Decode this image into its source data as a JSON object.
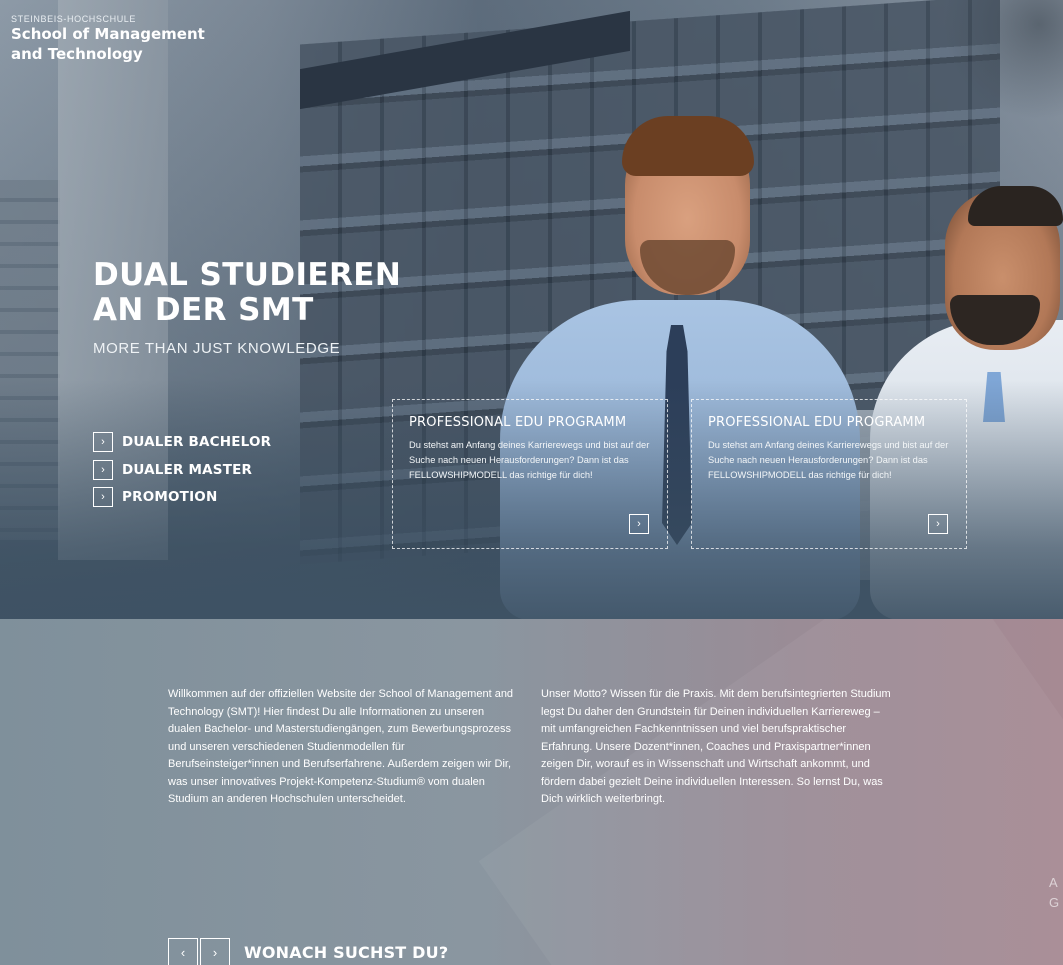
{
  "brand": {
    "small": "STEINBEIS-HOCHSCHULE",
    "line1": "School of Management",
    "line2": "and Technology"
  },
  "hero": {
    "title_line1": "DUAL STUDIEREN",
    "title_line2": "AN DER SMT",
    "subtitle": "MORE THAN JUST KNOWLEDGE",
    "nav": [
      {
        "icon": "chevron-right-icon",
        "glyph": "›",
        "label": "DUALER BACHELOR"
      },
      {
        "icon": "chevron-right-icon",
        "glyph": "›",
        "label": "DUALER MASTER"
      },
      {
        "icon": "chevron-right-icon",
        "glyph": "›",
        "label": "PROMOTION"
      }
    ],
    "cards": [
      {
        "title": "PROFESSIONAL EDU PROGRAMM",
        "text": "Du stehst am Anfang deines Karrierewegs und bist auf der Suche nach neuen Herausforderungen? Dann ist das FELLOWSHIPMODELL das richtige für dich!",
        "arrow": "›"
      },
      {
        "title": "PROFESSIONAL EDU PROGRAMM",
        "text": "Du stehst am Anfang deines Karrierewegs und bist auf der Suche nach neuen Herausforderungen? Dann ist das FELLOWSHIPMODELL das richtige für dich!",
        "arrow": "›"
      }
    ]
  },
  "intro": {
    "left": "Willkommen auf der offiziellen Website der School of Management and Technology (SMT)! Hier findest Du alle Informationen zu unseren dualen Bachelor- und Masterstudiengängen, zum Bewerbungsprozess und unseren verschiedenen Studienmodellen für Berufseinsteiger*innen und Berufserfahrene. Außerdem zeigen wir Dir, was unser innovatives Projekt-Kompetenz-Studium® vom dualen Studium an anderen Hochschulen unterscheidet.",
    "right": "Unser Motto? Wissen für die Praxis. Mit dem berufsintegrierten Studium legst Du daher den Grundstein für Deinen individuellen Karriereweg – mit umfangreichen Fachkenntnissen und viel berufspraktischer Erfahrung. Unsere Dozent*innen, Coaches und Praxispartner*innen zeigen Dir, worauf es in Wissenschaft und Wirtschaft ankommt, und fördern dabei gezielt Deine individuellen Interessen. So lernst Du, was Dich wirklich weiterbringt."
  },
  "edge_text": {
    "line1": "A",
    "line2": "G"
  },
  "search_section": {
    "prev": "‹",
    "next": "›",
    "title": "WONACH SUCHST DU?"
  },
  "colors": {
    "hero_overlay": "#3e5264",
    "lower_gradient_start": "#7f909b",
    "lower_gradient_end": "#a68a93"
  }
}
